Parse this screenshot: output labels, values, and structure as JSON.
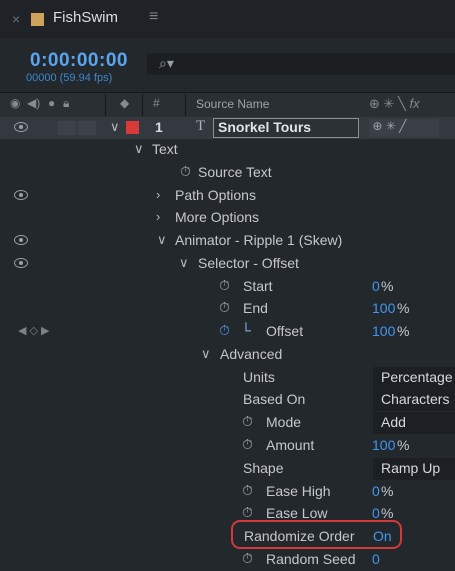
{
  "tab": {
    "close": "×",
    "name": "FishSwim",
    "menu": "≡"
  },
  "time": {
    "code": "0:00:00:00",
    "fps": "00000 (59.94 fps)"
  },
  "search": {
    "icon": "search-icon",
    "glyph": "⚲"
  },
  "header": {
    "source_name": "Source Name",
    "hash": "#"
  },
  "layer": {
    "number": "1",
    "type_glyph": "T",
    "name": "Snorkel Tours",
    "label_color": "#d83a3a"
  },
  "rows": {
    "text": "Text",
    "source_text": "Source Text",
    "path_options": "Path Options",
    "more_options": "More Options",
    "animator": "Animator - Ripple 1 (Skew)",
    "selector": "Selector - Offset",
    "start": {
      "label": "Start",
      "value": "0",
      "unit": "%"
    },
    "end": {
      "label": "End",
      "value": "100",
      "unit": "%"
    },
    "offset": {
      "label": "Offset",
      "value": "100",
      "unit": "%"
    },
    "advanced": "Advanced",
    "units": {
      "label": "Units",
      "value": "Percentage"
    },
    "based_on": {
      "label": "Based On",
      "value": "Characters"
    },
    "mode": {
      "label": "Mode",
      "value": "Add"
    },
    "amount": {
      "label": "Amount",
      "value": "100",
      "unit": "%"
    },
    "shape": {
      "label": "Shape",
      "value": "Ramp Up"
    },
    "ease_high": {
      "label": "Ease High",
      "value": "0",
      "unit": "%"
    },
    "ease_low": {
      "label": "Ease Low",
      "value": "0",
      "unit": "%"
    },
    "randomize_order": {
      "label": "Randomize Order",
      "value": "On"
    },
    "random_seed": {
      "label": "Random Seed",
      "value": "0"
    }
  },
  "colors": {
    "accent": "#3f97f0",
    "highlight": "#d23a3a",
    "label_tan": "#cfa15b"
  }
}
